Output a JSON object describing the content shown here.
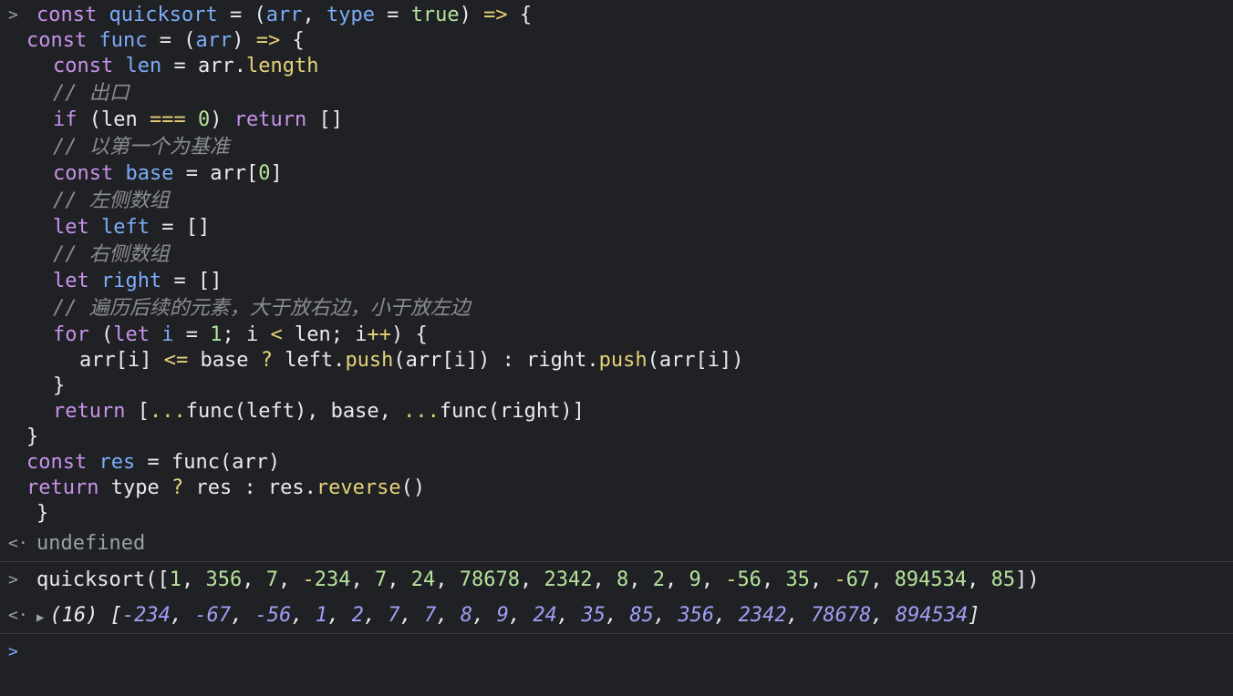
{
  "code": {
    "l1": {
      "kw": "const",
      "name": "quicksort",
      "eq": " = ",
      "open": "(",
      "p1": "arr",
      "comma": ", ",
      "p2": "type",
      "eq2": " = ",
      "val": "true",
      "close": ")",
      "arrow": " => ",
      "brace": "{"
    },
    "l2": {
      "kw": "const",
      "name": "func",
      "eq": " = ",
      "open": "(",
      "p1": "arr",
      "close": ")",
      "arrow": " => ",
      "brace": "{"
    },
    "l3": {
      "kw": "const",
      "name": "len",
      "eq": " = ",
      "obj": "arr.",
      "prop": "length"
    },
    "l4": {
      "comment": "// 出口"
    },
    "l5": {
      "kw": "if",
      "open": " (len ",
      "op": "===",
      "num": "0",
      "close": ") ",
      "kw2": "return",
      "rest": " []"
    },
    "l6": {
      "comment": "// 以第一个为基准"
    },
    "l7": {
      "kw": "const",
      "name": "base",
      "eq": " = ",
      "obj": "arr[",
      "num": "0",
      "close": "]"
    },
    "l8": {
      "comment": "// 左侧数组"
    },
    "l9": {
      "kw": "let",
      "name": "left",
      "rest": " = []"
    },
    "l10": {
      "comment": "// 右侧数组"
    },
    "l11": {
      "kw": "let",
      "name": "right",
      "rest": " = []"
    },
    "l12": {
      "comment": "// 遍历后续的元素，大于放右边，小于放左边"
    },
    "l13": {
      "kw": "for",
      "open": " (",
      "kw2": "let",
      "name": "i",
      "eq": " = ",
      "num": "1",
      "mid": "; i ",
      "op": "<",
      "mid2": " len; i",
      "op2": "++",
      "close": ") {"
    },
    "l14": {
      "a": "arr[i] ",
      "op": "<=",
      "b": " base ",
      "q": "?",
      "c": " left.",
      "push": "push",
      "d": "(arr[i]) : right.",
      "push2": "push",
      "e": "(arr[i])"
    },
    "l15": {
      "text": "}"
    },
    "l16": {
      "kw": "return",
      "a": " [",
      "spread": "...",
      "b": "func(left), base, ",
      "spread2": "...",
      "c": "func(right)]"
    },
    "l17": {
      "text": "}"
    },
    "l18": {
      "kw": "const",
      "name": "res",
      "rest": " = func(arr)"
    },
    "l19": {
      "kw": "return",
      "a": " type ",
      "q": "?",
      "b": " res : res.",
      "method": "reverse",
      "c": "()"
    },
    "l20": {
      "text": "}"
    }
  },
  "result1": "undefined",
  "call": {
    "name": "quicksort",
    "open": "([",
    "args": [
      "1",
      "356",
      "7",
      "-234",
      "7",
      "24",
      "78678",
      "2342",
      "8",
      "2",
      "9",
      "-56",
      "35",
      "-67",
      "894534",
      "85"
    ],
    "close": "])"
  },
  "result2": {
    "count": "(16)",
    "values": [
      "-234",
      "-67",
      "-56",
      "1",
      "2",
      "7",
      "7",
      "8",
      "9",
      "24",
      "35",
      "85",
      "356",
      "2342",
      "78678",
      "894534"
    ]
  },
  "prompt_symbol": ">",
  "result_symbol": "<·"
}
